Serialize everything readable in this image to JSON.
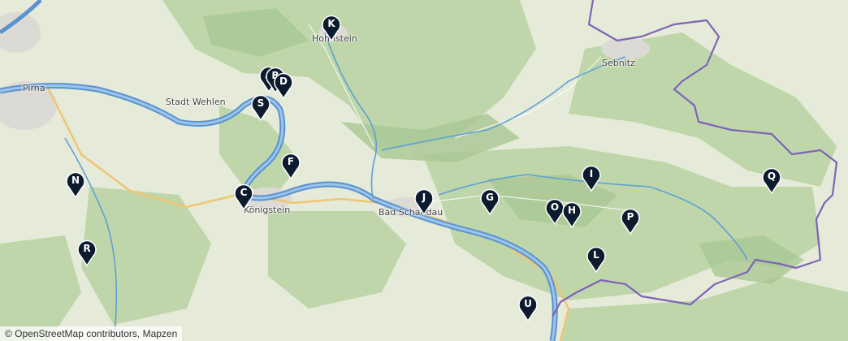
{
  "attribution": "© OpenStreetMap contributors, Mapzen",
  "places": {
    "pirna": "Pirna",
    "stadt_wehlen": "Stadt Wehlen",
    "hohnstein": "Hohnstein",
    "sebnitz": "Sebnitz",
    "koenigstein": "Königstein",
    "bad_schandau": "Bad Schandau"
  },
  "markers": {
    "a": "A",
    "b": "B",
    "c": "C",
    "d": "D",
    "f": "F",
    "g": "G",
    "h": "H",
    "i": "I",
    "j": "J",
    "k": "K",
    "l": "L",
    "n": "N",
    "o": "O",
    "p": "P",
    "q": "Q",
    "r": "R",
    "s": "S",
    "u": "U"
  },
  "colors": {
    "marker": "#0d1b2e",
    "river": "#4a86c8",
    "border": "#7e64b6",
    "forest": "#b9d3a6",
    "road": "#f1c77a"
  }
}
